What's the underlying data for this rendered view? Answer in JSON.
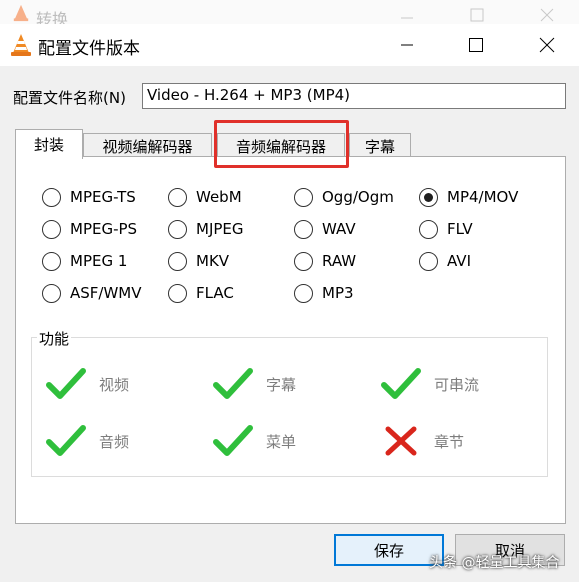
{
  "background_window": {
    "title": "转换"
  },
  "dialog": {
    "title": "配置文件版本"
  },
  "profile_name": {
    "label": "配置文件名称(N)",
    "value": "Video - H.264 + MP3 (MP4)"
  },
  "tabs": [
    {
      "label": "封装",
      "active": true
    },
    {
      "label": "视频编解码器",
      "active": false
    },
    {
      "label": "音频编解码器",
      "active": false,
      "highlighted": true
    },
    {
      "label": "字幕",
      "active": false
    }
  ],
  "containers": [
    {
      "label": "MPEG-TS",
      "selected": false
    },
    {
      "label": "WebM",
      "selected": false
    },
    {
      "label": "Ogg/Ogm",
      "selected": false
    },
    {
      "label": "MP4/MOV",
      "selected": true
    },
    {
      "label": "MPEG-PS",
      "selected": false
    },
    {
      "label": "MJPEG",
      "selected": false
    },
    {
      "label": "WAV",
      "selected": false
    },
    {
      "label": "FLV",
      "selected": false
    },
    {
      "label": "MPEG 1",
      "selected": false
    },
    {
      "label": "MKV",
      "selected": false
    },
    {
      "label": "RAW",
      "selected": false
    },
    {
      "label": "AVI",
      "selected": false
    },
    {
      "label": "ASF/WMV",
      "selected": false
    },
    {
      "label": "FLAC",
      "selected": false
    },
    {
      "label": "MP3",
      "selected": false
    }
  ],
  "features": {
    "group_label": "功能",
    "items": [
      {
        "label": "视频",
        "supported": true,
        "icon": "check-icon"
      },
      {
        "label": "字幕",
        "supported": true,
        "icon": "check-icon"
      },
      {
        "label": "可串流",
        "supported": true,
        "icon": "check-icon"
      },
      {
        "label": "音频",
        "supported": true,
        "icon": "check-icon"
      },
      {
        "label": "菜单",
        "supported": true,
        "icon": "check-icon"
      },
      {
        "label": "章节",
        "supported": false,
        "icon": "cross-icon"
      }
    ]
  },
  "buttons": {
    "save": "保存",
    "cancel": "取消"
  },
  "watermark": "头条 @轻量工具集合",
  "colors": {
    "check": "#2fbf3c",
    "cross": "#d9261c",
    "highlight": "#e0302a",
    "primary_border": "#0078d7"
  }
}
